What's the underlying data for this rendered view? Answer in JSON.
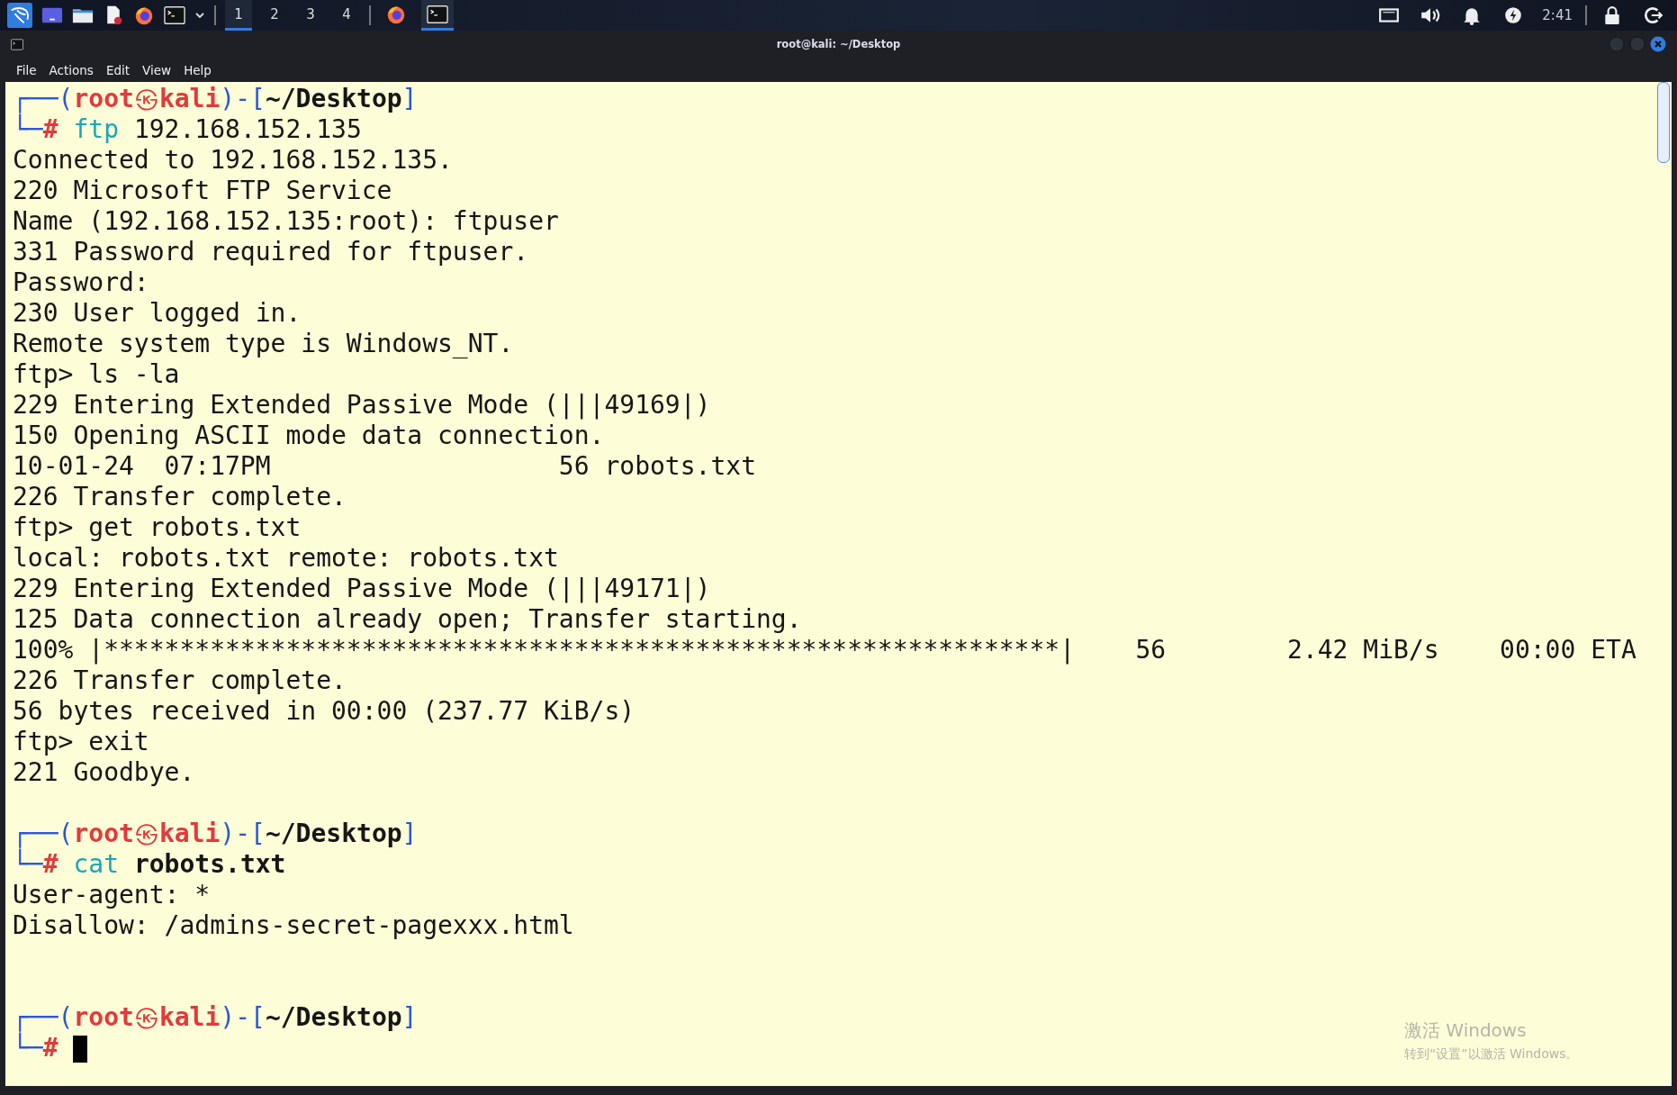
{
  "panel": {
    "launchers": [
      {
        "kind": "kali"
      },
      {
        "kind": "desktop"
      },
      {
        "kind": "files"
      },
      {
        "kind": "editor"
      },
      {
        "kind": "firefox"
      },
      {
        "kind": "terminal"
      },
      {
        "kind": "caret"
      }
    ],
    "workspaces": [
      {
        "label": "1",
        "selected": true
      },
      {
        "label": "2",
        "selected": false
      },
      {
        "label": "3",
        "selected": false
      },
      {
        "label": "4",
        "selected": false
      }
    ],
    "tasks": [
      {
        "kind": "firefox",
        "selected": false
      },
      {
        "kind": "terminal",
        "selected": true
      }
    ],
    "tray": [
      {
        "kind": "monitor"
      },
      {
        "kind": "volume"
      },
      {
        "kind": "bell"
      },
      {
        "kind": "power"
      }
    ],
    "clock": "2:41",
    "session": [
      {
        "kind": "lock"
      },
      {
        "kind": "logout"
      }
    ]
  },
  "window": {
    "title": "root@kali: ~/Desktop"
  },
  "menu": [
    "File",
    "Actions",
    "Edit",
    "View",
    "Help"
  ],
  "terminal": {
    "lines": [
      {
        "kind": "prompt",
        "open": "┌──(",
        "user": "root",
        "at": "㉿",
        "host": "kali",
        "mid": ")-[",
        "path": "~/Desktop",
        "close": "]",
        "corner": "└─",
        "symbol": "#",
        "command": "ftp",
        "argument": "192.168.152.135",
        "argument_bold": false,
        "cursor": false
      },
      {
        "kind": "output",
        "text": "Connected to 192.168.152.135."
      },
      {
        "kind": "output",
        "text": "220 Microsoft FTP Service"
      },
      {
        "kind": "output",
        "text": "Name (192.168.152.135:root): ftpuser"
      },
      {
        "kind": "output",
        "text": "331 Password required for ftpuser."
      },
      {
        "kind": "output",
        "text": "Password:"
      },
      {
        "kind": "output",
        "text": "230 User logged in."
      },
      {
        "kind": "output",
        "text": "Remote system type is Windows_NT."
      },
      {
        "kind": "output",
        "text": "ftp> ls -la"
      },
      {
        "kind": "output",
        "text": "229 Entering Extended Passive Mode (|||49169|)"
      },
      {
        "kind": "output",
        "text": "150 Opening ASCII mode data connection."
      },
      {
        "kind": "output",
        "text": "10-01-24  07:17PM                   56 robots.txt"
      },
      {
        "kind": "output",
        "text": "226 Transfer complete."
      },
      {
        "kind": "output",
        "text": "ftp> get robots.txt"
      },
      {
        "kind": "output",
        "text": "local: robots.txt remote: robots.txt"
      },
      {
        "kind": "output",
        "text": "229 Entering Extended Passive Mode (|||49171|)"
      },
      {
        "kind": "output",
        "text": "125 Data connection already open; Transfer starting."
      },
      {
        "kind": "output",
        "text": "100% |***************************************************************|    56        2.42 MiB/s    00:00 ETA"
      },
      {
        "kind": "output",
        "text": "226 Transfer complete."
      },
      {
        "kind": "output",
        "text": "56 bytes received in 00:00 (237.77 KiB/s)"
      },
      {
        "kind": "output",
        "text": "ftp> exit"
      },
      {
        "kind": "output",
        "text": "221 Goodbye."
      },
      {
        "kind": "blank"
      },
      {
        "kind": "prompt",
        "open": "┌──(",
        "user": "root",
        "at": "㉿",
        "host": "kali",
        "mid": ")-[",
        "path": "~/Desktop",
        "close": "]",
        "corner": "└─",
        "symbol": "#",
        "command": "cat",
        "argument": "robots.txt",
        "argument_bold": true,
        "cursor": false
      },
      {
        "kind": "output",
        "text": "User-agent: *"
      },
      {
        "kind": "output",
        "text": "Disallow: /admins-secret-pagexxx.html"
      },
      {
        "kind": "blank"
      },
      {
        "kind": "blank"
      },
      {
        "kind": "prompt",
        "open": "┌──(",
        "user": "root",
        "at": "㉿",
        "host": "kali",
        "mid": ")-[",
        "path": "~/Desktop",
        "close": "]",
        "corner": "└─",
        "symbol": "#",
        "cursor": true
      }
    ]
  },
  "os_notice": {
    "title": "激活 Windows",
    "subtitle": "转到“设置”以激活 Windows。"
  }
}
